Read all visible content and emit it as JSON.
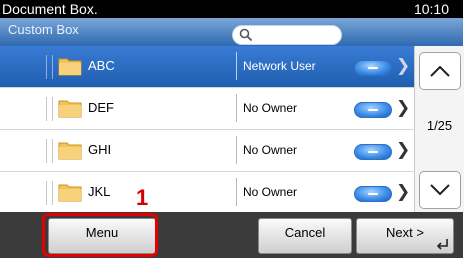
{
  "titlebar": {
    "title": "Document Box.",
    "clock": "10:10"
  },
  "subheader": {
    "breadcrumb": "Custom Box",
    "search_placeholder": ""
  },
  "rows": [
    {
      "name": "ABC",
      "owner": "Network User",
      "selected": true
    },
    {
      "name": "DEF",
      "owner": "No Owner",
      "selected": false
    },
    {
      "name": "GHI",
      "owner": "No Owner",
      "selected": false
    },
    {
      "name": "JKL",
      "owner": "No Owner",
      "selected": false
    }
  ],
  "pagination": {
    "page": "1/25"
  },
  "buttons": {
    "menu": "Menu",
    "cancel": "Cancel",
    "next": "Next >"
  },
  "annotation": {
    "step_number": "1"
  },
  "colors": {
    "selected_row": "#2a6cc7",
    "callout": "#e40000",
    "header": "#4f86c6"
  }
}
